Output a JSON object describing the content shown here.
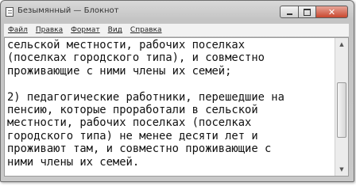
{
  "window": {
    "title": "Безымянный — Блокнот",
    "buttons": {
      "minimize_icon": "minimize-icon",
      "maximize_icon": "maximize-icon",
      "close_label": "✕"
    }
  },
  "menu": [
    {
      "label": "Файл"
    },
    {
      "label": "Правка"
    },
    {
      "label": "Формат"
    },
    {
      "label": "Вид"
    },
    {
      "label": "Справка"
    }
  ],
  "editor": {
    "lines": [
      "сельской местности, рабочих поселках",
      "(поселках городского типа), и совместно",
      "проживающие с ними члены их семей;",
      "",
      "2) педагогические работники, перешедшие на",
      "пенсию, которые проработали в сельской",
      "местности, рабочих поселках (поселках",
      "городского типа) не менее десяти лет и",
      "проживают там, и совместно проживающие с",
      "ними члены их семей."
    ]
  },
  "scrollbar": {
    "position": 0.55
  }
}
